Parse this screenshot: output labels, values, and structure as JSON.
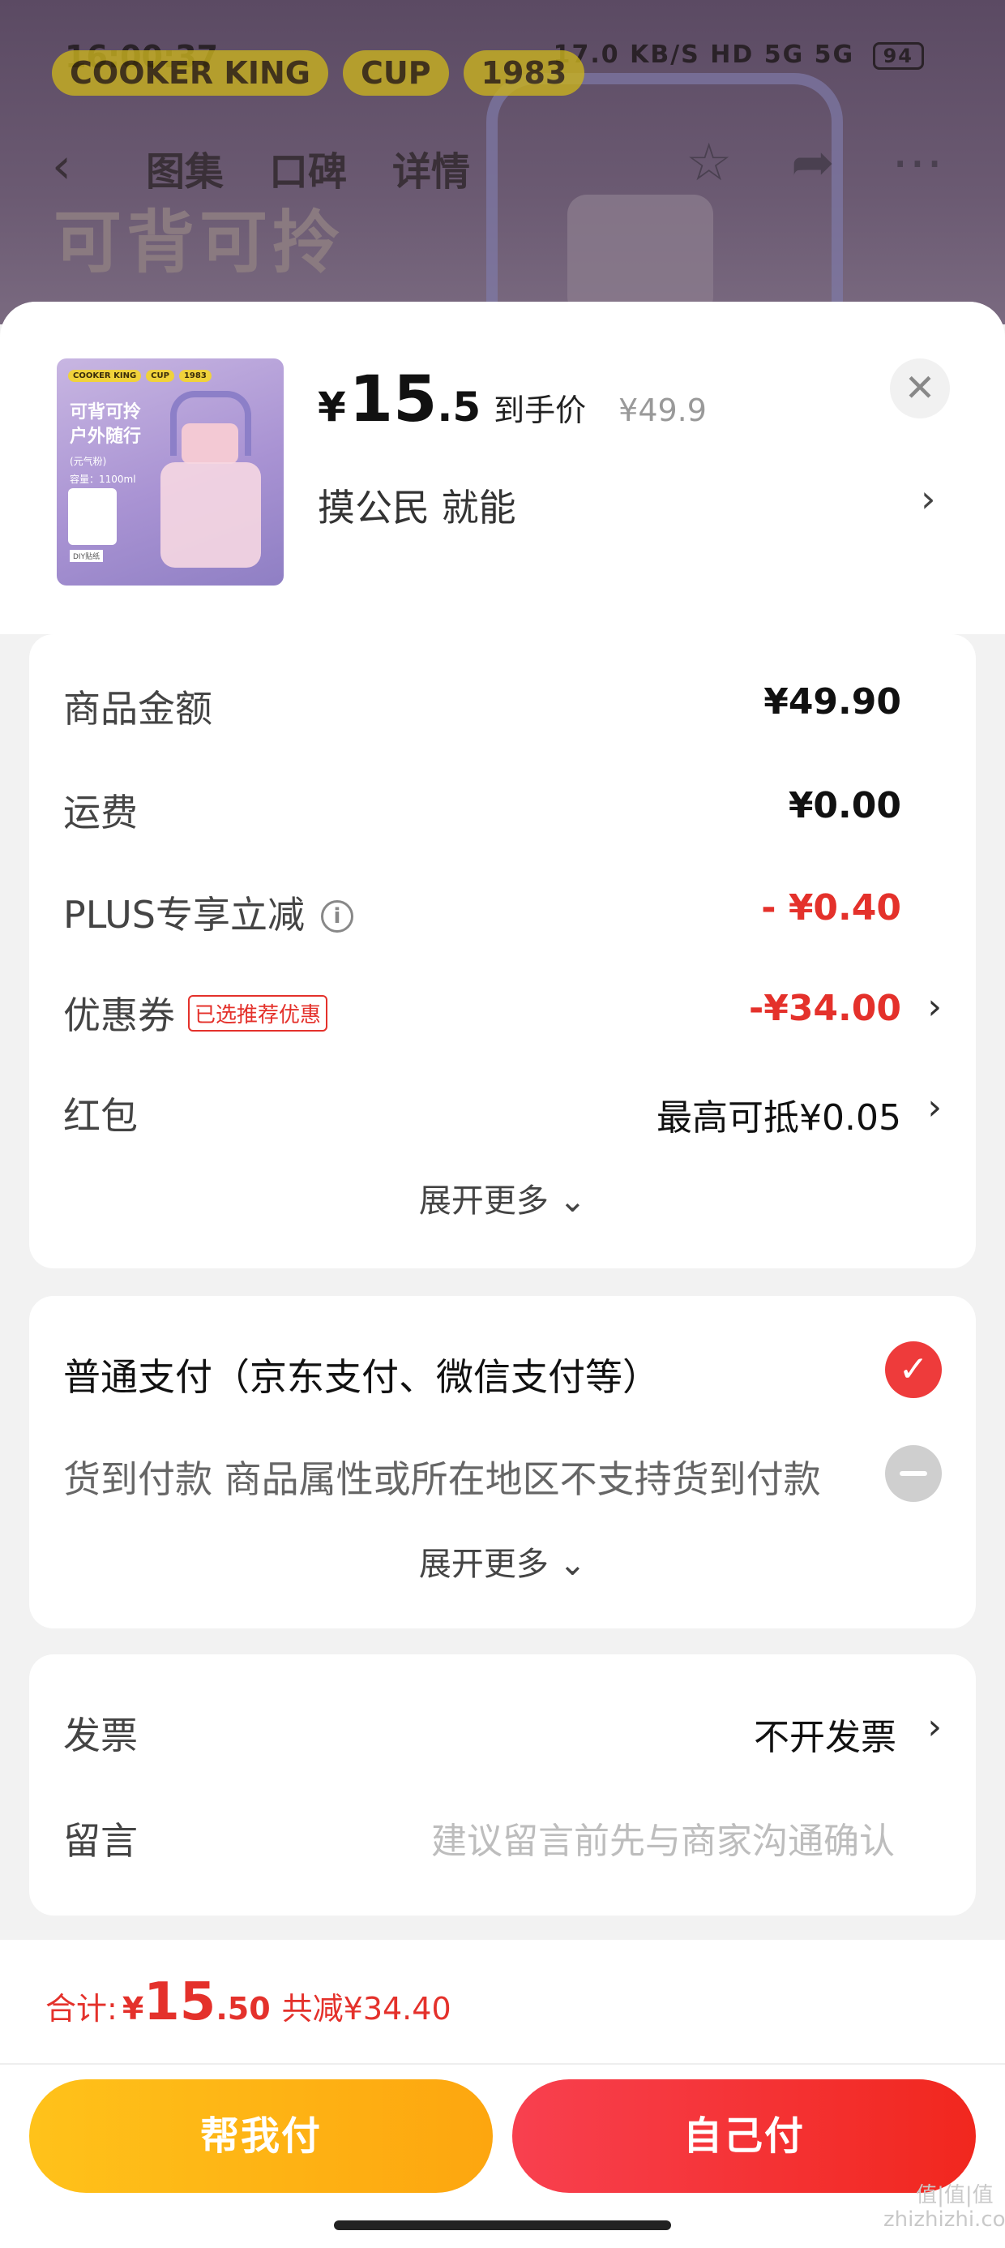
{
  "status_bar": {
    "time": "16:00:37",
    "net_speed": "17.0 KB/S",
    "indicators": "HD 5G 5G",
    "battery": "94"
  },
  "background_page": {
    "brand_tags": [
      "COOKER KING",
      "CUP",
      "1983"
    ],
    "nav_tabs": [
      "图集",
      "口碑",
      "详情"
    ],
    "headline": "可背可拎"
  },
  "product": {
    "thumb": {
      "tags": [
        "COOKER KING",
        "CUP",
        "1983"
      ],
      "line1": "可背可拎",
      "line2": "户外随行",
      "sub": "(元气粉)",
      "capacity": "容量：1100ml",
      "sticker_label": "DIY贴纸"
    },
    "price_symbol": "¥",
    "price_integer": "15",
    "price_decimal": ".5",
    "price_label": "到手价",
    "original_price": "¥49.9",
    "spec": "摸公民  就能",
    "close_symbol": "✕"
  },
  "amounts": {
    "rows": [
      {
        "label": "商品金额",
        "value": "¥49.90"
      },
      {
        "label": "运费",
        "value": "¥0.00"
      },
      {
        "label": "PLUS专享立减",
        "value": "- ¥0.40"
      },
      {
        "label": "优惠券",
        "value": "-¥34.00",
        "tag": "已选推荐优惠"
      },
      {
        "label": "红包",
        "value": "最高可抵¥0.05"
      }
    ],
    "expand": "展开更多 ⌄"
  },
  "payment": {
    "normal": "普通支付（京东支付、微信支付等）",
    "cod": "货到付款 商品属性或所在地区不支持货到付款",
    "expand": "展开更多 ⌄"
  },
  "invoice": {
    "invoice_label": "发票",
    "invoice_value": "不开发票",
    "message_label": "留言",
    "message_placeholder": "建议留言前先与商家沟通确认"
  },
  "footer": {
    "total_label": "合计:",
    "total_symbol": "¥",
    "total_integer": "15",
    "total_decimal": ".50",
    "total_saved": "共减¥34.40",
    "help_pay": "帮我付",
    "self_pay": "自己付",
    "watermark": "值|值|值 zhizhizhi.com"
  },
  "colors": {
    "accent_red": "#e4312b",
    "button_yellow": "#ffc21a",
    "button_red": "#f1271e"
  }
}
